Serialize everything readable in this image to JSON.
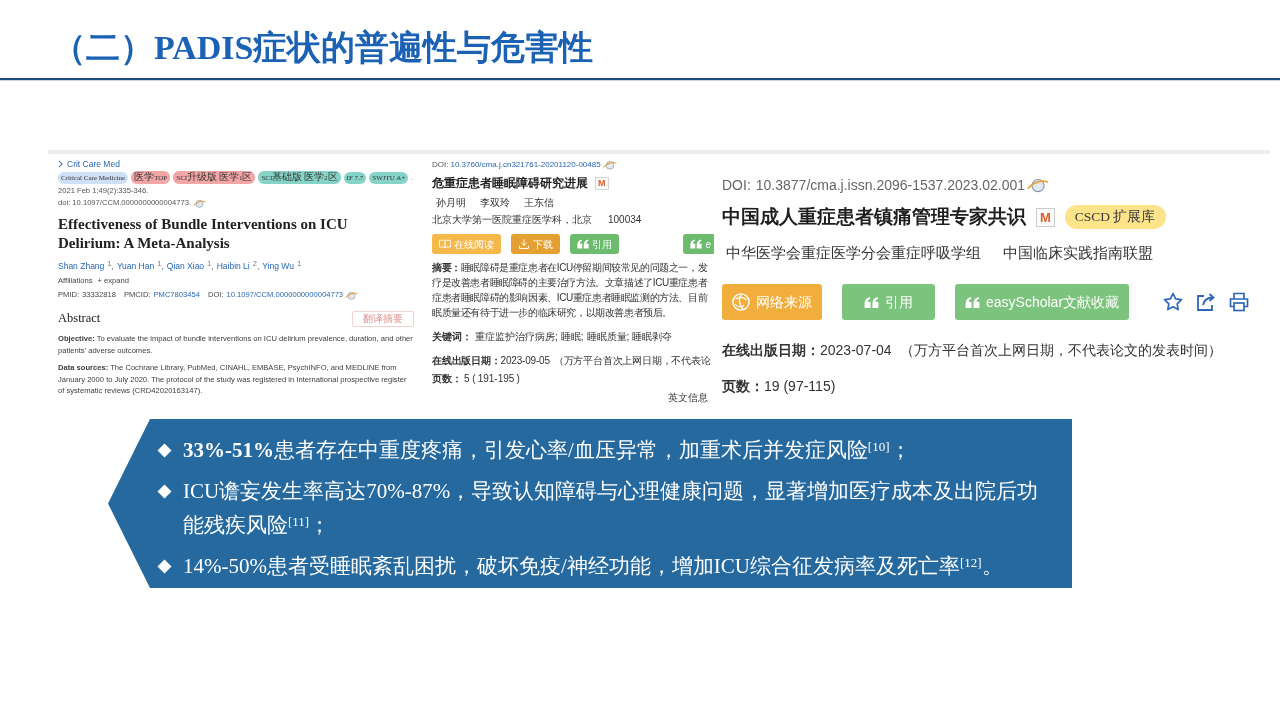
{
  "title": "（二）PADIS症状的普遍性与危害性",
  "article_left": {
    "journal": "Crit Care Med",
    "tags": [
      {
        "label": "Critical Care Medicine",
        "color": "#cde0f5"
      },
      {
        "label": "医学TOP",
        "color": "#f3a6a6"
      },
      {
        "label": "SCI升级版 医学1区",
        "color": "#f3a6a6"
      },
      {
        "label": "SCI基础版 医学2区",
        "color": "#86d4c8"
      },
      {
        "label": "IF 7.7",
        "color": "#86d4c8"
      },
      {
        "label": "SWJTU A+",
        "color": "#86d4c8"
      }
    ],
    "tags_end": ".",
    "citation": "2021 Feb 1;49(2):335-346.",
    "doi": "doi: 10.1097/CCM.0000000000004773.",
    "heading": "Effectiveness of Bundle Interventions on ICU Delirium: A Meta-Analysis",
    "authors": [
      {
        "name": "Shan Zhang",
        "sup": "1",
        "punct": ","
      },
      {
        "name": "Yuan Han",
        "sup": "1",
        "punct": ","
      },
      {
        "name": "Qian Xiao",
        "sup": "1",
        "punct": ","
      },
      {
        "name": "Haibin Li",
        "sup": "2",
        "punct": ","
      },
      {
        "name": "Ying Wu",
        "sup": "1"
      }
    ],
    "affiliations": "Affiliations",
    "expand": "+ expand",
    "ids": [
      {
        "label": "PMID:",
        "value": "33332818",
        "link": false
      },
      {
        "label": "PMCID:",
        "value": "PMC7803454",
        "link": true
      },
      {
        "label": "DOI:",
        "value": "10.1097/CCM.0000000000004773",
        "link": true
      }
    ],
    "abstract_heading": "Abstract",
    "translate_button": "翻译摘要",
    "paragraphs": [
      "**Objective:** To evaluate the impact of bundle interventions on ICU delirium prevalence, duration, and other patients' adverse outcomes.",
      "**Data sources:** The Cochrane Library, PubMed, CINAHL, EMBASE, PsychINFO, and MEDLINE from January 2000 to July 2020. The protocol of the study was registered in International prospective register of systematic reviews (CRD42020163147)."
    ]
  },
  "article_middle": {
    "doi_label": "DOI:",
    "doi": "10.3760/cma.j.cn321761-20201120-00485",
    "heading": "危重症患者睡眠障碍研究进展",
    "tile": "M",
    "authors": [
      "孙月明",
      "李双玲",
      "王东信"
    ],
    "affiliation": [
      "北京大学第一医院重症医学科，北京",
      "100034"
    ],
    "buttons": [
      {
        "label": "在线阅读",
        "kind": "read",
        "color": "#f5b84b"
      },
      {
        "label": "下载",
        "kind": "download",
        "color": "#e4a031"
      },
      {
        "label": "引用",
        "kind": "cite",
        "color": "#6dbb6f"
      },
      {
        "label": "e",
        "kind": "cite",
        "color": "#6dbb6f"
      }
    ],
    "abstract_lines": [
      "**摘要：**睡眠障碍是重症患者在ICU停留期间较常见的问题之一，发",
      "疗是改善患者睡眠障碍的主要治疗方法。文章描述了ICU重症患者",
      "症患者睡眠障碍的影响因素、ICU重症患者睡眠监测的方法、目前",
      "眠质量还有待于进一步的临床研究，以期改善患者预后。"
    ],
    "keywords_label": "关键词：",
    "keywords": [
      "重症监护治疗病房;",
      "睡眠;",
      "睡眠质量;",
      "睡眠剥夺"
    ],
    "date_label": "在线出版日期：",
    "date": "2023-09-05",
    "date_note": "（万方平台首次上网日期，不代表论",
    "pages_label": "页数：",
    "pages_count": "5 (",
    "pages_range": "191-195",
    "pages_close": ")",
    "english_info": "英文信息"
  },
  "article_right": {
    "doi_label": "DOI:",
    "doi": "10.3877/cma.j.issn.2096-1537.2023.02.001",
    "heading": "中国成人重症患者镇痛管理专家共识",
    "tile": "M",
    "badge": "CSCD 扩展库",
    "authors": [
      "中华医学会重症医学分会重症呼吸学组",
      "中国临床实践指南联盟"
    ],
    "buttons": [
      {
        "label": "网络来源",
        "kind": "source",
        "color": "#f2ae3d"
      },
      {
        "label": "引用",
        "kind": "cite",
        "color": "#7cc47e"
      },
      {
        "label": "easyScholar文献收藏",
        "kind": "cite",
        "color": "#7cc47e"
      }
    ],
    "date_label": "在线出版日期：",
    "date": "2023-07-04",
    "date_note": "（万方平台首次上网日期，不代表论文的发表时间）",
    "pages_label": "页数：",
    "pages": "19 (97-115)"
  },
  "banner_points": [
    "**33%-51%**患者存在中重度疼痛，引发心率/血压异常，加重术后并发症风险$^{[10]}$；",
    "ICU谵妄发生率高达70%-87%，导致认知障碍与心理健康问题，显著增加医疗成本及出院后功能残疾风险$^{[11]}$；",
    "14%-50%患者受睡眠紊乱困扰，破坏免疫/神经功能，增加ICU综合征发病率及死亡率$^{[12]}$。"
  ]
}
